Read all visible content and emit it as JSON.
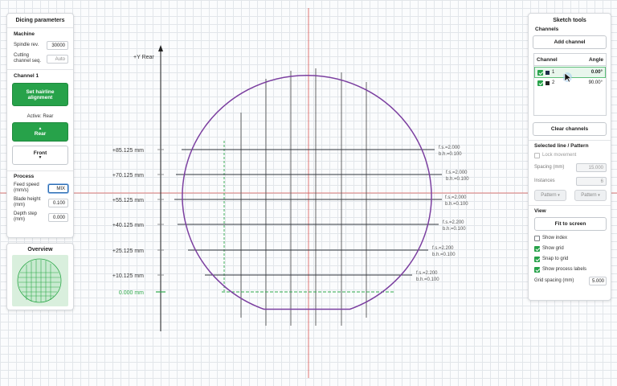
{
  "canvas": {
    "y_axis_label": "+Y Rear",
    "y_labels": [
      "+85.125 mm",
      "+70.125 mm",
      "+55.125 mm",
      "+40.125 mm",
      "+25.125 mm",
      "+10.125 mm",
      "0.000 mm"
    ],
    "process_labels": [
      {
        "fs": "f.s.=2.000",
        "bh": "b.h.=0.100"
      },
      {
        "fs": "f.s.=2.000",
        "bh": "b.h.=0.100"
      },
      {
        "fs": "f.s.=2.000",
        "bh": "b.h.=0.100"
      },
      {
        "fs": "f.s.=2.200",
        "bh": "b.h.=0.100"
      },
      {
        "fs": "f.s.=2.200",
        "bh": "b.h.=0.100"
      },
      {
        "fs": "f.s.=2.200",
        "bh": "b.h.=0.100"
      }
    ],
    "colors": {
      "wafer": "#7b3fa0",
      "cut_line": "#2f343a",
      "origin": "#2ea84a",
      "center_line": "#d9534f"
    }
  },
  "left_panel": {
    "title": "Dicing parameters",
    "machine": {
      "heading": "Machine",
      "spindle_label": "Spindle rev.",
      "spindle_value": "30000",
      "cutting_label": "Cutting channel seq.",
      "cutting_value": "Auto"
    },
    "channel": {
      "heading": "Channel 1",
      "hairline_button": "Set hairline alignment",
      "active_label": "Active: Rear",
      "rear_button": "Rear",
      "front_button": "Front"
    },
    "process": {
      "heading": "Process",
      "feed_label": "Feed speed (mm/s)",
      "feed_value": "MIX",
      "blade_label": "Blade height (mm)",
      "blade_value": "0.100",
      "depth_label": "Depth step (mm)",
      "depth_value": "0.000"
    }
  },
  "overview": {
    "title": "Overview"
  },
  "right_panel": {
    "title": "Sketch tools",
    "channels_heading": "Channels",
    "add_channel": "Add channel",
    "table_headers": {
      "channel": "Channel",
      "angle": "Angle"
    },
    "channel_rows": [
      {
        "name": "1",
        "angle": "0.00°",
        "checked": true,
        "selected": true
      },
      {
        "name": "2",
        "angle": "90.00°",
        "checked": true,
        "selected": false
      }
    ],
    "clear_channels": "Clear channels",
    "selected_heading": "Selected line / Pattern",
    "lock_movement": "Lock movement",
    "spacing_label": "Spacing (mm)",
    "spacing_value": "15.000",
    "instances_label": "Instances",
    "instances_value": "6",
    "pattern_button_1": "Pattern",
    "pattern_button_2": "Pattern",
    "view_heading": "View",
    "fit_button": "Fit to screen",
    "show_index": "Show index",
    "show_grid": "Show grid",
    "snap_grid": "Snap to grid",
    "show_process": "Show process labels",
    "grid_spacing_label": "Grid spacing (mm)",
    "grid_spacing_value": "5.000"
  }
}
